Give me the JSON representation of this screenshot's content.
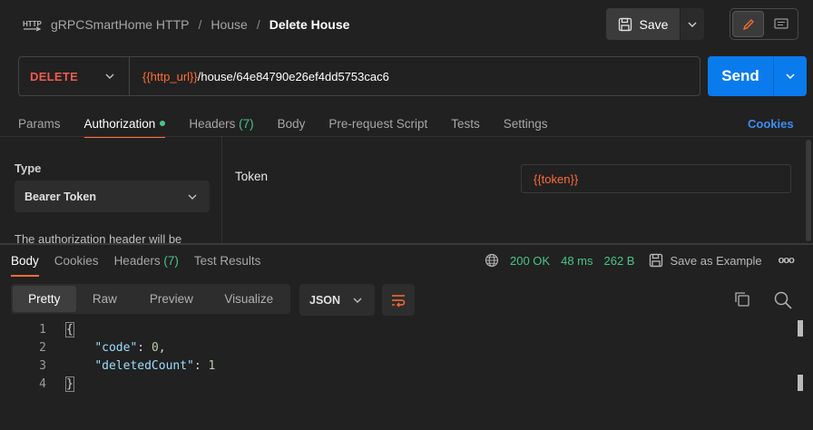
{
  "header": {
    "collection_icon_text": "HTTP",
    "breadcrumbs": [
      "gRPCSmartHome HTTP",
      "House"
    ],
    "current": "Delete House",
    "save_label": "Save"
  },
  "request": {
    "method": "DELETE",
    "url_variable": "{{http_url}}",
    "url_path": "/house/64e84790e26ef4dd5753cac6",
    "send_label": "Send"
  },
  "request_tabs": {
    "params": "Params",
    "authorization": "Authorization",
    "headers": "Headers",
    "headers_count": "(7)",
    "body": "Body",
    "pre_request": "Pre-request Script",
    "tests": "Tests",
    "settings": "Settings",
    "cookies": "Cookies"
  },
  "auth": {
    "type_label": "Type",
    "type_value": "Bearer Token",
    "description": "The authorization header will be",
    "token_label": "Token",
    "token_value": "{{token}}"
  },
  "response_tabs": {
    "body": "Body",
    "cookies": "Cookies",
    "headers": "Headers",
    "headers_count": "(7)",
    "test_results": "Test Results"
  },
  "response_meta": {
    "status": "200 OK",
    "time": "48 ms",
    "size": "262 B",
    "save_example": "Save as Example",
    "more": "ooo"
  },
  "view": {
    "pretty": "Pretty",
    "raw": "Raw",
    "preview": "Preview",
    "visualize": "Visualize",
    "format": "JSON"
  },
  "code": {
    "line_numbers": [
      "1",
      "2",
      "3",
      "4"
    ],
    "open_brace": "{",
    "key1": "\"code\"",
    "val1": "0",
    "key2": "\"deletedCount\"",
    "val2": "1",
    "close_brace": "}"
  },
  "colors": {
    "method": "#f05a4f",
    "accent": "#ff6c37",
    "status_ok": "#49c584",
    "send": "#097bed",
    "link": "#3d8ef5"
  }
}
